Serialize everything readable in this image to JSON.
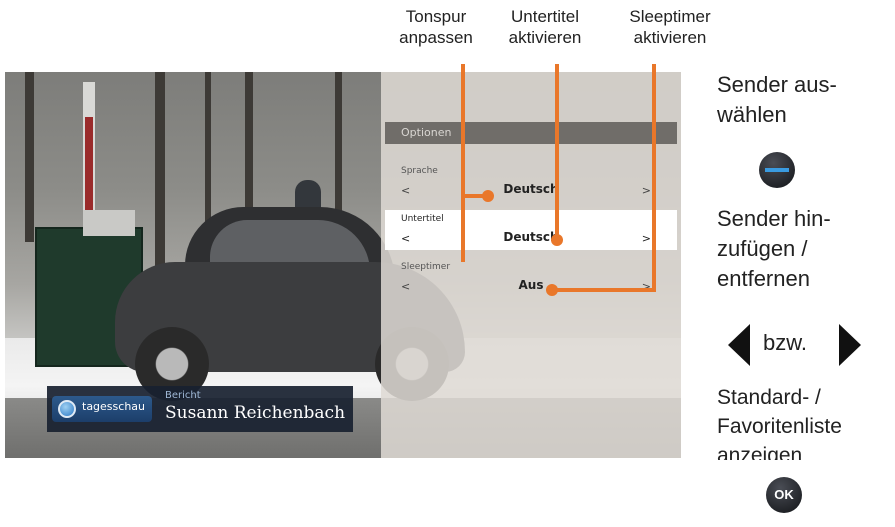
{
  "annotations": {
    "tonspur": [
      "Tonspur",
      "anpassen"
    ],
    "untertitel": [
      "Untertitel",
      "aktivieren"
    ],
    "sleeptimer": [
      "Sleeptimer",
      "aktivieren"
    ]
  },
  "overlay": {
    "title": "Optionen",
    "options": [
      {
        "name": "Sprache",
        "value": "Deutsch",
        "left": "<",
        "right": ">"
      },
      {
        "name": "Untertitel",
        "value": "Deutsch",
        "left": "<",
        "right": ">"
      },
      {
        "name": "Sleeptimer",
        "value": "Aus",
        "left": "<",
        "right": ">"
      }
    ],
    "selected_option": "Untertitel"
  },
  "lower_third": {
    "logo": "tagesschau",
    "kicker": "Bericht",
    "name": "Susann Reichenbach"
  },
  "legend": {
    "auswaehlen": [
      "Sender aus-",
      "wählen"
    ],
    "hinzufuegen": [
      "Sender hin-",
      "zufügen /",
      "entfernen"
    ],
    "bzw": "bzw.",
    "standard": [
      "Standard- /",
      "Favoritenliste",
      "anzeigen"
    ],
    "ok_label": "OK"
  },
  "colors": {
    "accent_orange": "#e9772a",
    "overlay_header": "#706d69",
    "lower_third_bg": "#182130",
    "minus_button_bar": "#3a9be0"
  },
  "icons": [
    "minus-button-icon",
    "arrow-left-icon",
    "arrow-right-icon",
    "ok-button-icon",
    "tagesschau-globe-icon"
  ]
}
